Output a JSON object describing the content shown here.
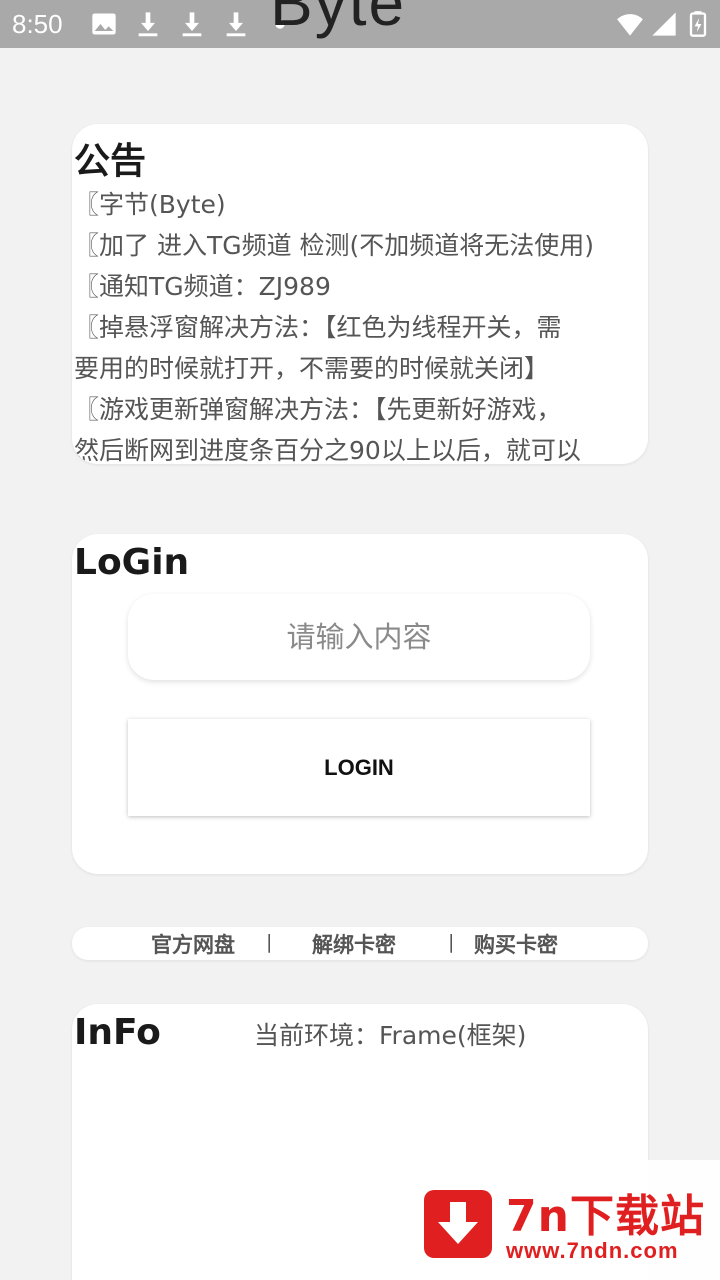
{
  "status_bar": {
    "time": "8:50",
    "icons": [
      "image-icon",
      "download-icon",
      "download-icon",
      "download-icon",
      "dot-icon",
      "wifi-icon",
      "signal-icon",
      "battery-icon"
    ]
  },
  "app": {
    "title": "Byte"
  },
  "notice": {
    "title": "公告",
    "lines": [
      "〖字节(Byte)",
      "〖加了 进入TG频道 检测(不加频道将无法使用)",
      "〖通知TG频道：ZJ989",
      "〖掉悬浮窗解决方法：【红色为线程开关，需",
      "要用的时候就打开，不需要的时候就关闭】",
      "〖游戏更新弹窗解决方法：【先更新好游戏，",
      "然后断网到进度条百分之90以上以后，就可以"
    ]
  },
  "login": {
    "title": "LoGin",
    "input_placeholder": "请输入内容",
    "input_value": "",
    "button_label": "LOGIN"
  },
  "links": {
    "items": [
      "官方网盘",
      "解绑卡密",
      "购买卡密"
    ],
    "separator": "|"
  },
  "info": {
    "title": "InFo",
    "environment": "当前环境：Frame(框架)"
  },
  "watermark": {
    "brand": "7n下载站",
    "url": "www.7ndn.com",
    "color": "#e02020"
  },
  "colors": {
    "status_bar_bg": "#a9a9a9",
    "page_bg": "#f2f2f2",
    "card_bg": "#ffffff"
  }
}
